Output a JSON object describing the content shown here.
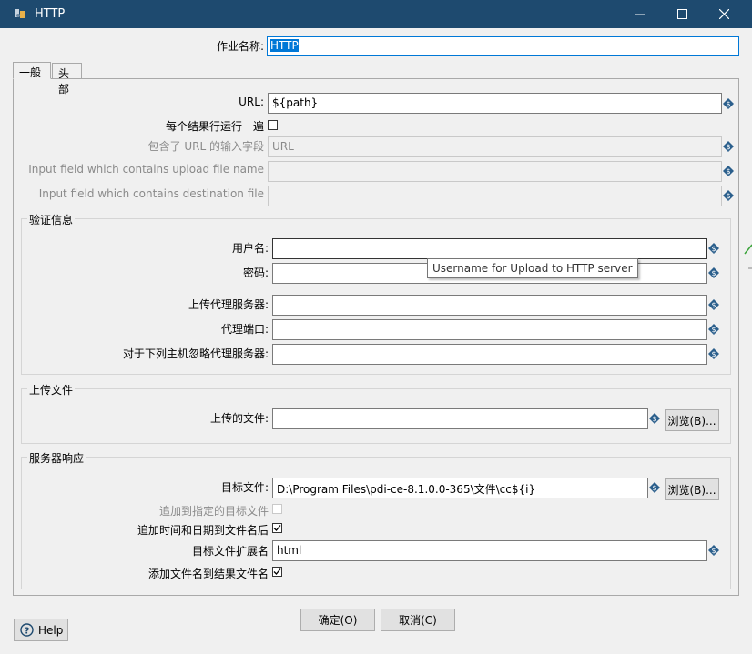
{
  "window": {
    "title": "HTTP"
  },
  "job_name": {
    "label": "作业名称:",
    "value": "HTTP"
  },
  "tabs": [
    {
      "label": "一般"
    },
    {
      "label": "头部"
    }
  ],
  "general": {
    "url": {
      "label": "URL:",
      "value": "${path}"
    },
    "run_every_row": {
      "label": "每个结果行运行一遍",
      "checked": false
    },
    "url_field": {
      "label": "包含了 URL 的输入字段",
      "value": "URL"
    },
    "upload_field": {
      "label": "Input field which contains upload file name",
      "value": ""
    },
    "dest_field": {
      "label": "Input field which contains destination file",
      "value": ""
    }
  },
  "auth": {
    "title": "验证信息",
    "username": {
      "label": "用户名:",
      "value": ""
    },
    "password": {
      "label": "密码:",
      "value": ""
    },
    "proxy_server": {
      "label": "上传代理服务器:",
      "value": ""
    },
    "proxy_port": {
      "label": "代理端口:",
      "value": ""
    },
    "non_proxy_hosts": {
      "label": "对于下列主机忽略代理服务器:",
      "value": ""
    },
    "tooltip": "Username for Upload to HTTP server"
  },
  "upload": {
    "title": "上传文件",
    "file": {
      "label": "上传的文件:",
      "value": ""
    },
    "browse_label": "浏览(B)..."
  },
  "response": {
    "title": "服务器响应",
    "target_file": {
      "label": "目标文件:",
      "value": "D:\\Program Files\\pdi-ce-8.1.0.0-365\\文件\\cc${i}"
    },
    "browse_label": "浏览(B)...",
    "append_target": {
      "label": "追加到指定的目标文件",
      "checked": false
    },
    "add_datetime": {
      "label": "追加时间和日期到文件名后",
      "checked": true
    },
    "extension": {
      "label": "目标文件扩展名",
      "value": "html"
    },
    "add_to_result": {
      "label": "添加文件名到结果文件名",
      "checked": true
    }
  },
  "buttons": {
    "ok": "确定(O)",
    "cancel": "取消(C)",
    "help": "Help"
  },
  "colors": {
    "titlebar": "#1e4a6f",
    "selection": "#0078d7",
    "variable_icon": "#2b5f8c"
  }
}
